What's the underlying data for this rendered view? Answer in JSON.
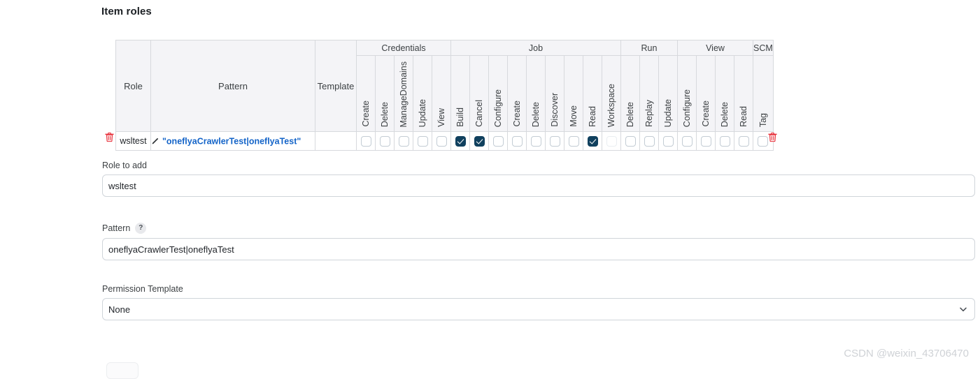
{
  "section": {
    "title": "Item roles"
  },
  "table": {
    "left_headers": {
      "role": "Role",
      "pattern": "Pattern",
      "template": "Template"
    },
    "groups": [
      {
        "label": "Credentials",
        "span": 5
      },
      {
        "label": "Job",
        "span": 9
      },
      {
        "label": "Run",
        "span": 3
      },
      {
        "label": "View",
        "span": 4
      },
      {
        "label": "SCM",
        "span": 1
      }
    ],
    "columns": [
      "Create",
      "Delete",
      "ManageDomains",
      "Update",
      "View",
      "Build",
      "Cancel",
      "Configure",
      "Create",
      "Delete",
      "Discover",
      "Move",
      "Read",
      "Workspace",
      "Delete",
      "Replay",
      "Update",
      "Configure",
      "Create",
      "Delete",
      "Read",
      "Tag"
    ],
    "rows": [
      {
        "role": "wsltest",
        "pattern": "\"oneflyaCrawlerTest|oneflyaTest\"",
        "template": "",
        "checked": [
          false,
          false,
          false,
          false,
          false,
          true,
          true,
          false,
          false,
          false,
          false,
          false,
          true,
          false,
          false,
          false,
          false,
          false,
          false,
          false,
          false,
          false
        ],
        "faint": [
          false,
          false,
          false,
          false,
          false,
          false,
          false,
          false,
          false,
          false,
          false,
          false,
          false,
          true,
          false,
          false,
          false,
          false,
          false,
          false,
          false,
          false
        ]
      }
    ],
    "delete_row_icon": "trash-icon"
  },
  "form": {
    "role_to_add": {
      "label": "Role to add",
      "value": "wsltest",
      "placeholder": ""
    },
    "pattern": {
      "label": "Pattern",
      "help": "?",
      "value": "oneflyaCrawlerTest|oneflyaTest",
      "placeholder": ""
    },
    "permission_template": {
      "label": "Permission Template",
      "value": "None",
      "options": [
        "None"
      ]
    }
  },
  "watermark": {
    "text": "CSDN @weixin_43706470"
  },
  "colors": {
    "checkbox_on": "#10405e",
    "pattern_link": "#1464c8",
    "trash": "#e8323c",
    "header_bg": "#f4f4f7",
    "border": "#d7d9dd"
  }
}
